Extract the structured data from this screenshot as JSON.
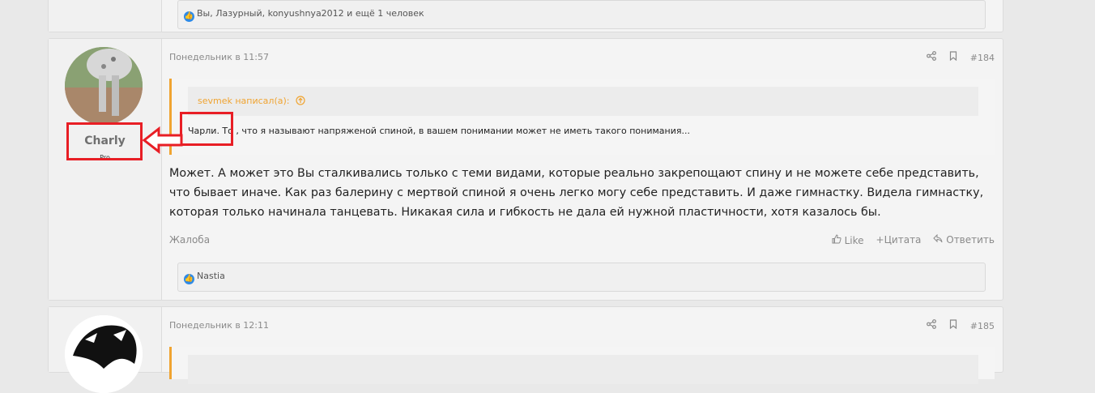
{
  "post_top": {
    "reactions_text": "Вы, Лазурный, konyushnya2012 и ещё 1 человек"
  },
  "post_main": {
    "username": "Charly",
    "user_title": "Pro",
    "date": "Понедельник в 11:57",
    "post_number": "#184",
    "quote": {
      "author": "sevmek написал(а):",
      "text": "Чарли. То , что я называют напряженой спиной, в вашем понимании может не иметь такого понимания..."
    },
    "message": "Может. А может это Вы сталкивались только с теми видами, которые реально закрепощают спину и не можете себе представить, что бывает иначе. Как раз балерину с мертвой спиной я очень легко могу себе представить. И даже гимнастку. Видела гимнастку, которая только начинала танцевать. Никакая сила и гибкость не дала ей нужной пластичности, хотя казалось бы.",
    "report": "Жалоба",
    "actions": {
      "like": "Like",
      "quote": "Цитата",
      "reply": "Ответить"
    },
    "reactions_text": "Nastia"
  },
  "post_next": {
    "date": "Понедельник в 12:11",
    "post_number": "#185"
  },
  "icons": {
    "share": "share-icon",
    "bookmark": "bookmark-icon",
    "like": "thumbs-up-icon",
    "quote": "plus-icon",
    "reply": "reply-arrow-icon",
    "quote_up": "arrow-circle-up-icon"
  },
  "colors": {
    "accent": "#f0a431",
    "annotation": "#e81e25",
    "like_badge": "#2e8ae6"
  }
}
